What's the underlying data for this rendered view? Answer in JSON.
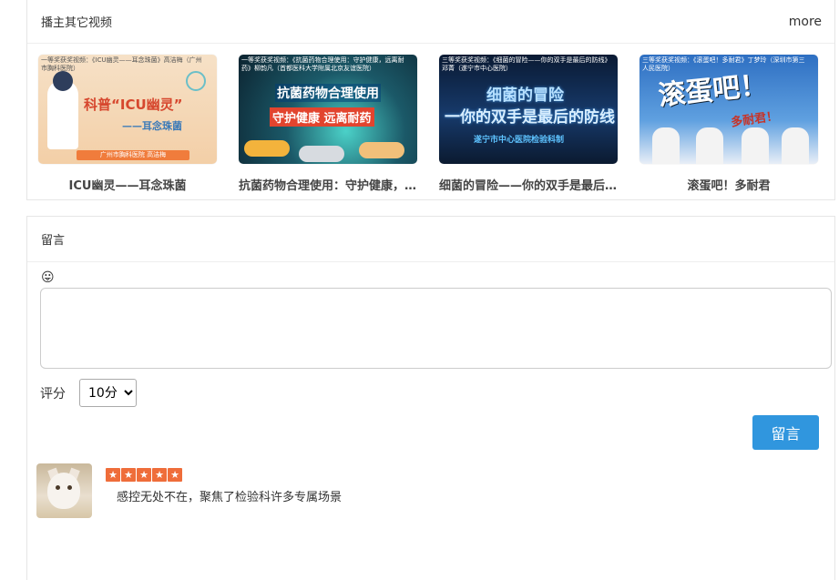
{
  "videos_panel": {
    "title": "播主其它视频",
    "more_label": "more",
    "videos": [
      {
        "title": "ICU幽灵——耳念珠菌",
        "thumb_caption": "一等奖获奖视频：《ICU幽灵——耳念珠菌》高洁梅（广州市胸科医院）",
        "thumb_text_1": "科普“ICU幽灵”",
        "thumb_text_2": "——耳念珠菌",
        "thumb_footer": "广州市胸科医院 高洁梅"
      },
      {
        "title": "抗菌药物合理使用：守护健康，远离耐药",
        "thumb_caption": "一等奖获奖视频：《抗菌药物合理使用：守护健康，远离耐药》柳韵凡（首都医科大学附属北京友谊医院）",
        "thumb_text_1": "抗菌药物合理使用",
        "thumb_text_2": "守护健康  远离耐药"
      },
      {
        "title": "细菌的冒险——你的双手是最后的防线",
        "thumb_caption": "三等奖获奖视频：《细菌的冒险——你的双手是最后的防线》邓菁（遂宁市中心医院）",
        "thumb_text_1": "细菌的冒险",
        "thumb_text_2": "一你的双手是最后的防线",
        "thumb_text_3": "遂宁市中心医院检验科制"
      },
      {
        "title": "滚蛋吧！多耐君",
        "thumb_caption": "三等奖获奖视频：《滚蛋吧！多耐君》丁梦玲（深圳市第三人民医院）",
        "thumb_text_1": "滚蛋吧！",
        "thumb_text_2": "多耐君！"
      }
    ]
  },
  "comment_panel": {
    "title": "留言",
    "emoji": "😛",
    "rating_label": "评分",
    "rating_selected": "10分",
    "submit_label": "留言",
    "comments": [
      {
        "rating": 5,
        "star_glyph": "★",
        "text": "感控无处不在，聚焦了检验科许多专属场景"
      }
    ]
  },
  "colors": {
    "accent_button": "#3096de",
    "star": "#ef6d3a"
  }
}
